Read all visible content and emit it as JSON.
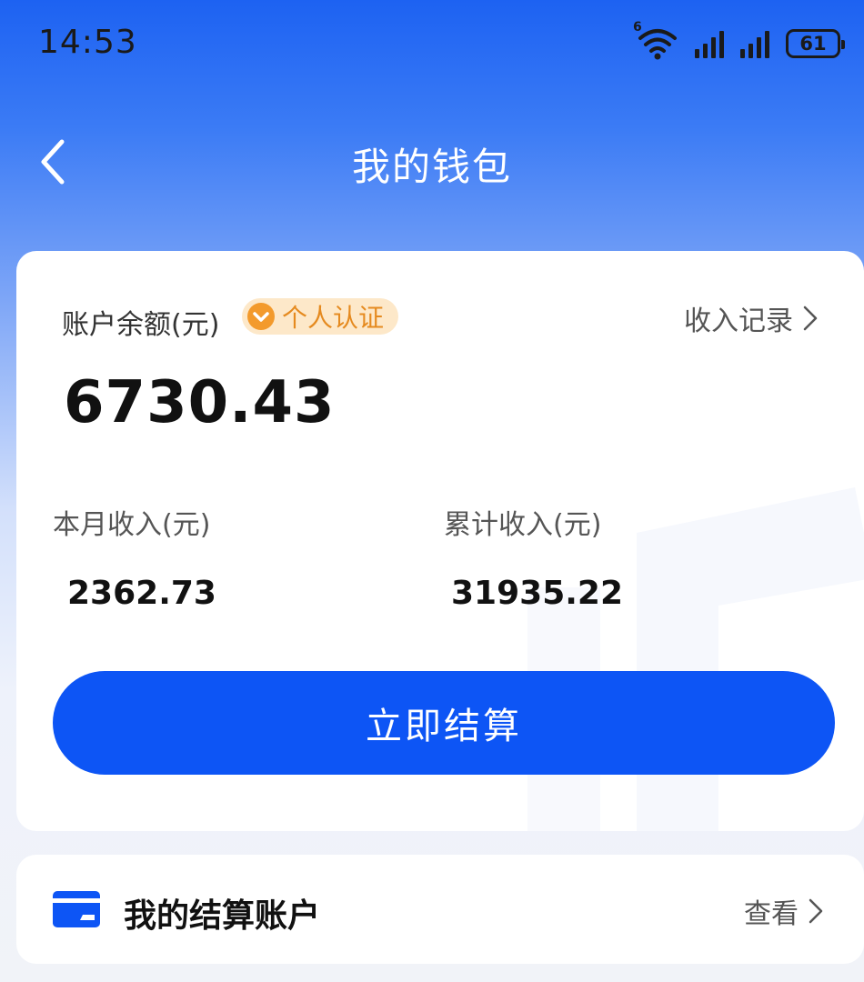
{
  "status_bar": {
    "time": "14:53",
    "wifi_label": "6",
    "battery_level": "61"
  },
  "nav": {
    "title": "我的钱包"
  },
  "wallet": {
    "balance_label": "账户余额(元)",
    "badge_label": "个人认证",
    "income_record_label": "收入记录",
    "balance_value": "6730.43",
    "month_income_label": "本月收入(元)",
    "month_income_value": "2362.73",
    "total_income_label": "累计收入(元)",
    "total_income_value": "31935.22",
    "settle_button_label": "立即结算"
  },
  "account": {
    "title": "我的结算账户",
    "view_label": "查看"
  },
  "colors": {
    "primary": "#0d55f5",
    "header_gradient_top": "#1d62f2",
    "badge_bg": "#fde8c9",
    "badge_text": "#e58a1f"
  },
  "icons": [
    "back-icon",
    "wifi-icon",
    "signal-icon",
    "battery-icon",
    "verified-icon",
    "chevron-right-icon",
    "card-icon"
  ]
}
